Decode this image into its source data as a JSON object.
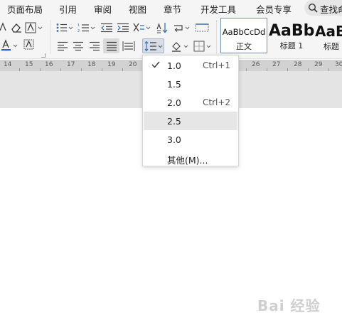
{
  "menu": {
    "tabs": [
      "页面布局",
      "引用",
      "审阅",
      "视图",
      "章节",
      "开发工具",
      "会员专享"
    ],
    "search_label": "查找命令"
  },
  "ribbon": {
    "styles": [
      {
        "sample": "AaBbCcDd",
        "name": "正文"
      },
      {
        "sample": "AaBb",
        "name": "标题 1"
      },
      {
        "sample": "AaB",
        "name": "标题"
      }
    ]
  },
  "ruler": {
    "numbers": [
      "14",
      "15",
      "16",
      "17",
      "18",
      "19",
      "20",
      "26",
      "27",
      "28",
      "29",
      "30"
    ]
  },
  "line_spacing_menu": {
    "items": [
      {
        "value": "1.0",
        "shortcut": "Ctrl+1",
        "checked": true
      },
      {
        "value": "1.5",
        "shortcut": "",
        "checked": false
      },
      {
        "value": "2.0",
        "shortcut": "Ctrl+2",
        "checked": false
      },
      {
        "value": "2.5",
        "shortcut": "",
        "checked": false,
        "hovered": true
      },
      {
        "value": "3.0",
        "shortcut": "",
        "checked": false
      },
      {
        "value": "其他(M)...",
        "shortcut": "",
        "checked": false
      }
    ]
  },
  "watermark": "Bai 经验",
  "colors": {
    "font_color_underline": "#2b5cd6",
    "icon_blue": "#3c6fb0",
    "highlight": "#dadada"
  }
}
